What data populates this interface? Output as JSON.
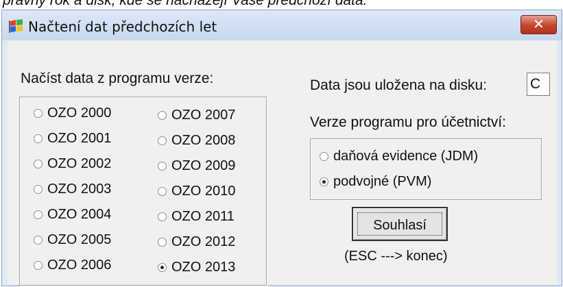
{
  "caption": "pravný rok a disk, kde se nacházejí Vaše předchozí data.",
  "window": {
    "title": "Načtení dat předchozích let",
    "icon": "windows-flag-icon",
    "close_label": "✕"
  },
  "left_label": "Načíst data z programu verze:",
  "versions_col1": [
    {
      "label": "OZO 2000",
      "checked": false
    },
    {
      "label": "OZO 2001",
      "checked": false
    },
    {
      "label": "OZO 2002",
      "checked": false
    },
    {
      "label": "OZO 2003",
      "checked": false
    },
    {
      "label": "OZO 2004",
      "checked": false
    },
    {
      "label": "OZO 2005",
      "checked": false
    },
    {
      "label": "OZO 2006",
      "checked": false
    }
  ],
  "versions_col2": [
    {
      "label": "OZO 2007",
      "checked": false
    },
    {
      "label": "OZO 2008",
      "checked": false
    },
    {
      "label": "OZO 2009",
      "checked": false
    },
    {
      "label": "OZO 2010",
      "checked": false
    },
    {
      "label": "OZO 2011",
      "checked": false
    },
    {
      "label": "OZO 2012",
      "checked": false
    },
    {
      "label": "OZO 2013",
      "checked": true
    }
  ],
  "disk": {
    "label": "Data jsou uložena na disku:",
    "value": "C"
  },
  "accounting": {
    "label": "Verze programu pro účetnictví:",
    "options": [
      {
        "label": "daňová evidence (JDM)",
        "checked": false
      },
      {
        "label": "podvojné (PVM)",
        "checked": true
      }
    ]
  },
  "buttons": {
    "agree_label": "Souhlasí"
  },
  "hint": "(ESC ---> konec)"
}
